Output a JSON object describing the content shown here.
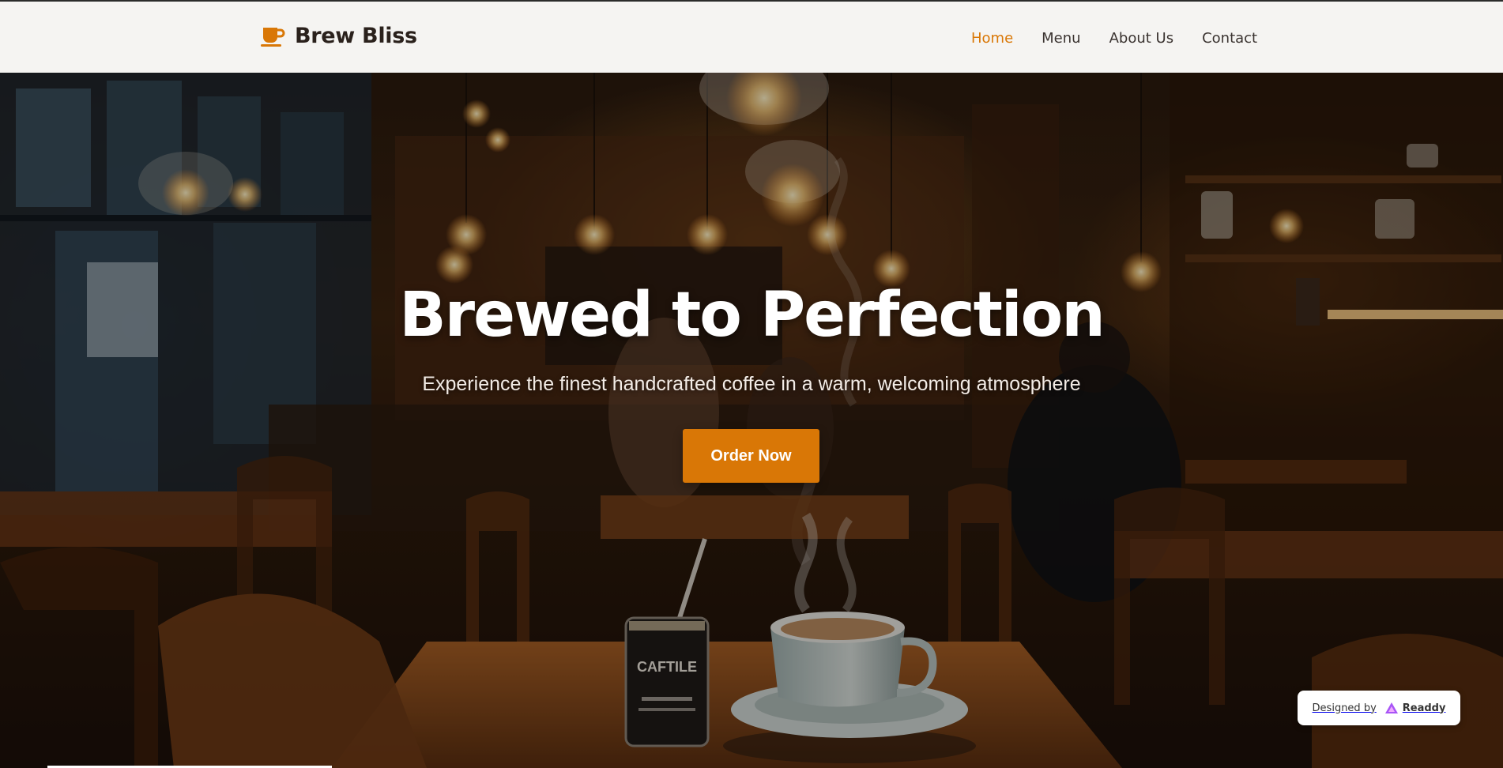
{
  "brand": {
    "name": "Brew Bliss",
    "icon": "coffee-cup-icon"
  },
  "nav": {
    "links": [
      {
        "label": "Home",
        "active": true
      },
      {
        "label": "Menu",
        "active": false
      },
      {
        "label": "About Us",
        "active": false
      },
      {
        "label": "Contact",
        "active": false
      }
    ]
  },
  "hero": {
    "title": "Brewed to Perfection",
    "subtitle": "Experience the finest handcrafted coffee in a warm, welcoming atmosphere",
    "cta_label": "Order Now",
    "jar_label": "CAFTILE"
  },
  "badge": {
    "label": "Designed by",
    "brand": "Readdy",
    "icon": "readdy-logo-icon"
  },
  "colors": {
    "accent": "#d97706",
    "nav_bg": "#f5f4f2",
    "text_dark": "#2a211c"
  }
}
